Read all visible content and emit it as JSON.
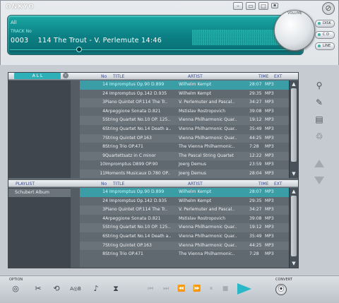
{
  "app": {
    "brand": "ONKYO"
  },
  "titlebar": {
    "close": "⊘"
  },
  "display": {
    "category": "All",
    "track_label": "TRACK No",
    "track_no": "0003",
    "track_title": "114 The Trout - V. Perlemute",
    "time": "14:46",
    "progress": 0.24
  },
  "volume": {
    "label": "VOLUME"
  },
  "side_buttons": [
    {
      "label": "DISK"
    },
    {
      "label": "C D"
    },
    {
      "label": "LINE"
    }
  ],
  "library": {
    "filter_label": "A L L",
    "columns": {
      "no": "No",
      "title": "TITLE",
      "artist": "ARTIST",
      "time": "TIME",
      "ext": "EXT"
    },
    "rows": [
      {
        "no": "1",
        "title": "4 Impromptus Op.90 D.899",
        "artist": "Wilhelm Kempt",
        "time": "28:07",
        "ext": "MP3"
      },
      {
        "no": "2",
        "title": "4 Impromptus Op.142 D.935",
        "artist": "Wilhelm Kempt",
        "time": "29:35",
        "ext": "MP3"
      },
      {
        "no": "3",
        "title": "Piano Quintet OP.114 The Tr..",
        "artist": "V. Perlemuter and Pascal..",
        "time": "34:27",
        "ext": "MP3"
      },
      {
        "no": "4",
        "title": "Arpeggione Sonata D.821",
        "artist": "Mstislav Rostropovich",
        "time": "39:08",
        "ext": "MP3"
      },
      {
        "no": "5",
        "title": "String Quartet No.10 OP. 125..",
        "artist": "Vienna Philharmonic Quar..",
        "time": "19:12",
        "ext": "MP3"
      },
      {
        "no": "6",
        "title": "String Quartet No.14 Death a..",
        "artist": "Vienna Philharmonic Quar..",
        "time": "35:49",
        "ext": "MP3"
      },
      {
        "no": "7",
        "title": "String Quintet OP.163",
        "artist": "Vienna Philharmonic Quar..",
        "time": "44:25",
        "ext": "MP3"
      },
      {
        "no": "8",
        "title": "String Trio OP.471",
        "artist": "The Vienna Philharmonic..",
        "time": "7:28",
        "ext": "MP3"
      },
      {
        "no": "9",
        "title": "Quartettsatz in C minor",
        "artist": "The Pascal String Quartet",
        "time": "12:22",
        "ext": "MP3"
      },
      {
        "no": "10",
        "title": "Impromptus D899 OP.90",
        "artist": "Joerg Demus",
        "time": "23:59",
        "ext": "MP3"
      },
      {
        "no": "11",
        "title": "Moments Musicaux D.780 OP..",
        "artist": "Joerg Demus",
        "time": "28:04",
        "ext": "MP3"
      }
    ]
  },
  "playlist": {
    "header": "PLAYLIST",
    "items": [
      "Schubert Album"
    ],
    "columns": {
      "no": "No",
      "title": "TITLE",
      "artist": "ARTIST",
      "time": "TIME",
      "ext": "EXT"
    },
    "rows": [
      {
        "no": "1",
        "title": "4 Impromptus Op.90 D.899",
        "artist": "Wilhelm Kempt",
        "time": "28:07",
        "ext": "MP3"
      },
      {
        "no": "2",
        "title": "4 Impromptus Op.142 D.935",
        "artist": "Wilhelm Kempt",
        "time": "29:35",
        "ext": "MP3"
      },
      {
        "no": "3",
        "title": "Piano Quintet OP.114 The Tr..",
        "artist": "V. Perlemuter and Pascal..",
        "time": "34:27",
        "ext": "MP3"
      },
      {
        "no": "4",
        "title": "Arpeggione Sonata D.821",
        "artist": "Mstislav Rostropovich",
        "time": "39:08",
        "ext": "MP3"
      },
      {
        "no": "5",
        "title": "String Quartet No.10 OP. 125..",
        "artist": "Vienna Philharmonic Quar..",
        "time": "19:12",
        "ext": "MP3"
      },
      {
        "no": "6",
        "title": "String Quartet No.14 Death a..",
        "artist": "Vienna Philharmonic Quar..",
        "time": "35:49",
        "ext": "MP3"
      },
      {
        "no": "7",
        "title": "String Quintet OP.163",
        "artist": "Vienna Philharmonic Quar..",
        "time": "44:25",
        "ext": "MP3"
      },
      {
        "no": "8",
        "title": "String Trio OP.471",
        "artist": "The Vienna Philharmonic..",
        "time": "7:28",
        "ext": "MP3"
      }
    ]
  },
  "footer": {
    "option_label": "OPTION",
    "convert_label": "CONVERT",
    "ab_label": "A◎B"
  },
  "colors": {
    "display": "#0b8a8c",
    "selected_row": "#3b9da5",
    "play_accent": "#2ab7c8"
  }
}
